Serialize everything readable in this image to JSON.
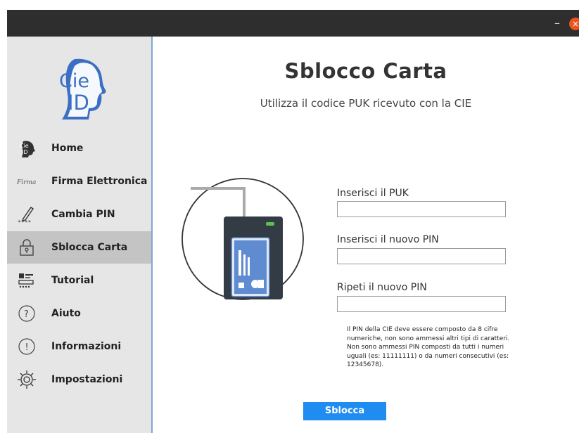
{
  "window": {
    "minimize_glyph": "–",
    "close_glyph": "×",
    "close_color": "#e95420",
    "titlebar_color": "#2e2e2e"
  },
  "sidebar": {
    "logo_text_top": "Cie",
    "logo_text_bottom": "ID",
    "active_color": "#c4c4c4",
    "items": [
      {
        "label": "Home",
        "icon": "cie-id-icon",
        "active": false,
        "icon_text_top": "Cie",
        "icon_text_bottom": "ID"
      },
      {
        "label": "Firma Elettronica",
        "icon": "signature-icon",
        "active": false,
        "icon_text": "Firma"
      },
      {
        "label": "Cambia PIN",
        "icon": "pencil-pin-icon",
        "active": false,
        "icon_text": "****"
      },
      {
        "label": "Sblocca Carta",
        "icon": "padlock-icon",
        "active": true
      },
      {
        "label": "Tutorial",
        "icon": "tutorial-icon",
        "active": false
      },
      {
        "label": "Aiuto",
        "icon": "question-icon",
        "active": false,
        "icon_text": "?"
      },
      {
        "label": "Informazioni",
        "icon": "info-icon",
        "active": false,
        "icon_text": "!"
      },
      {
        "label": "Impostazioni",
        "icon": "gear-icon",
        "active": false
      }
    ]
  },
  "main": {
    "title": "Sblocco Carta",
    "subtitle": "Utilizza il codice PUK ricevuto con la CIE",
    "puk_label": "Inserisci il PUK",
    "puk_value": "",
    "new_pin_label": "Inserisci il nuovo PIN",
    "new_pin_value": "",
    "repeat_pin_label": "Ripeti il nuovo PIN",
    "repeat_pin_value": "",
    "note": "Il PIN della CIE deve essere composto da 8 cifre numeriche, non sono ammessi altri tipi di caratteri. Non sono ammessi PIN composti da tutti i numeri uguali (es: 11111111) o da numeri consecutivi (es: 12345678).",
    "unlock_button": "Sblocca",
    "accent_color": "#1e8cf0"
  }
}
